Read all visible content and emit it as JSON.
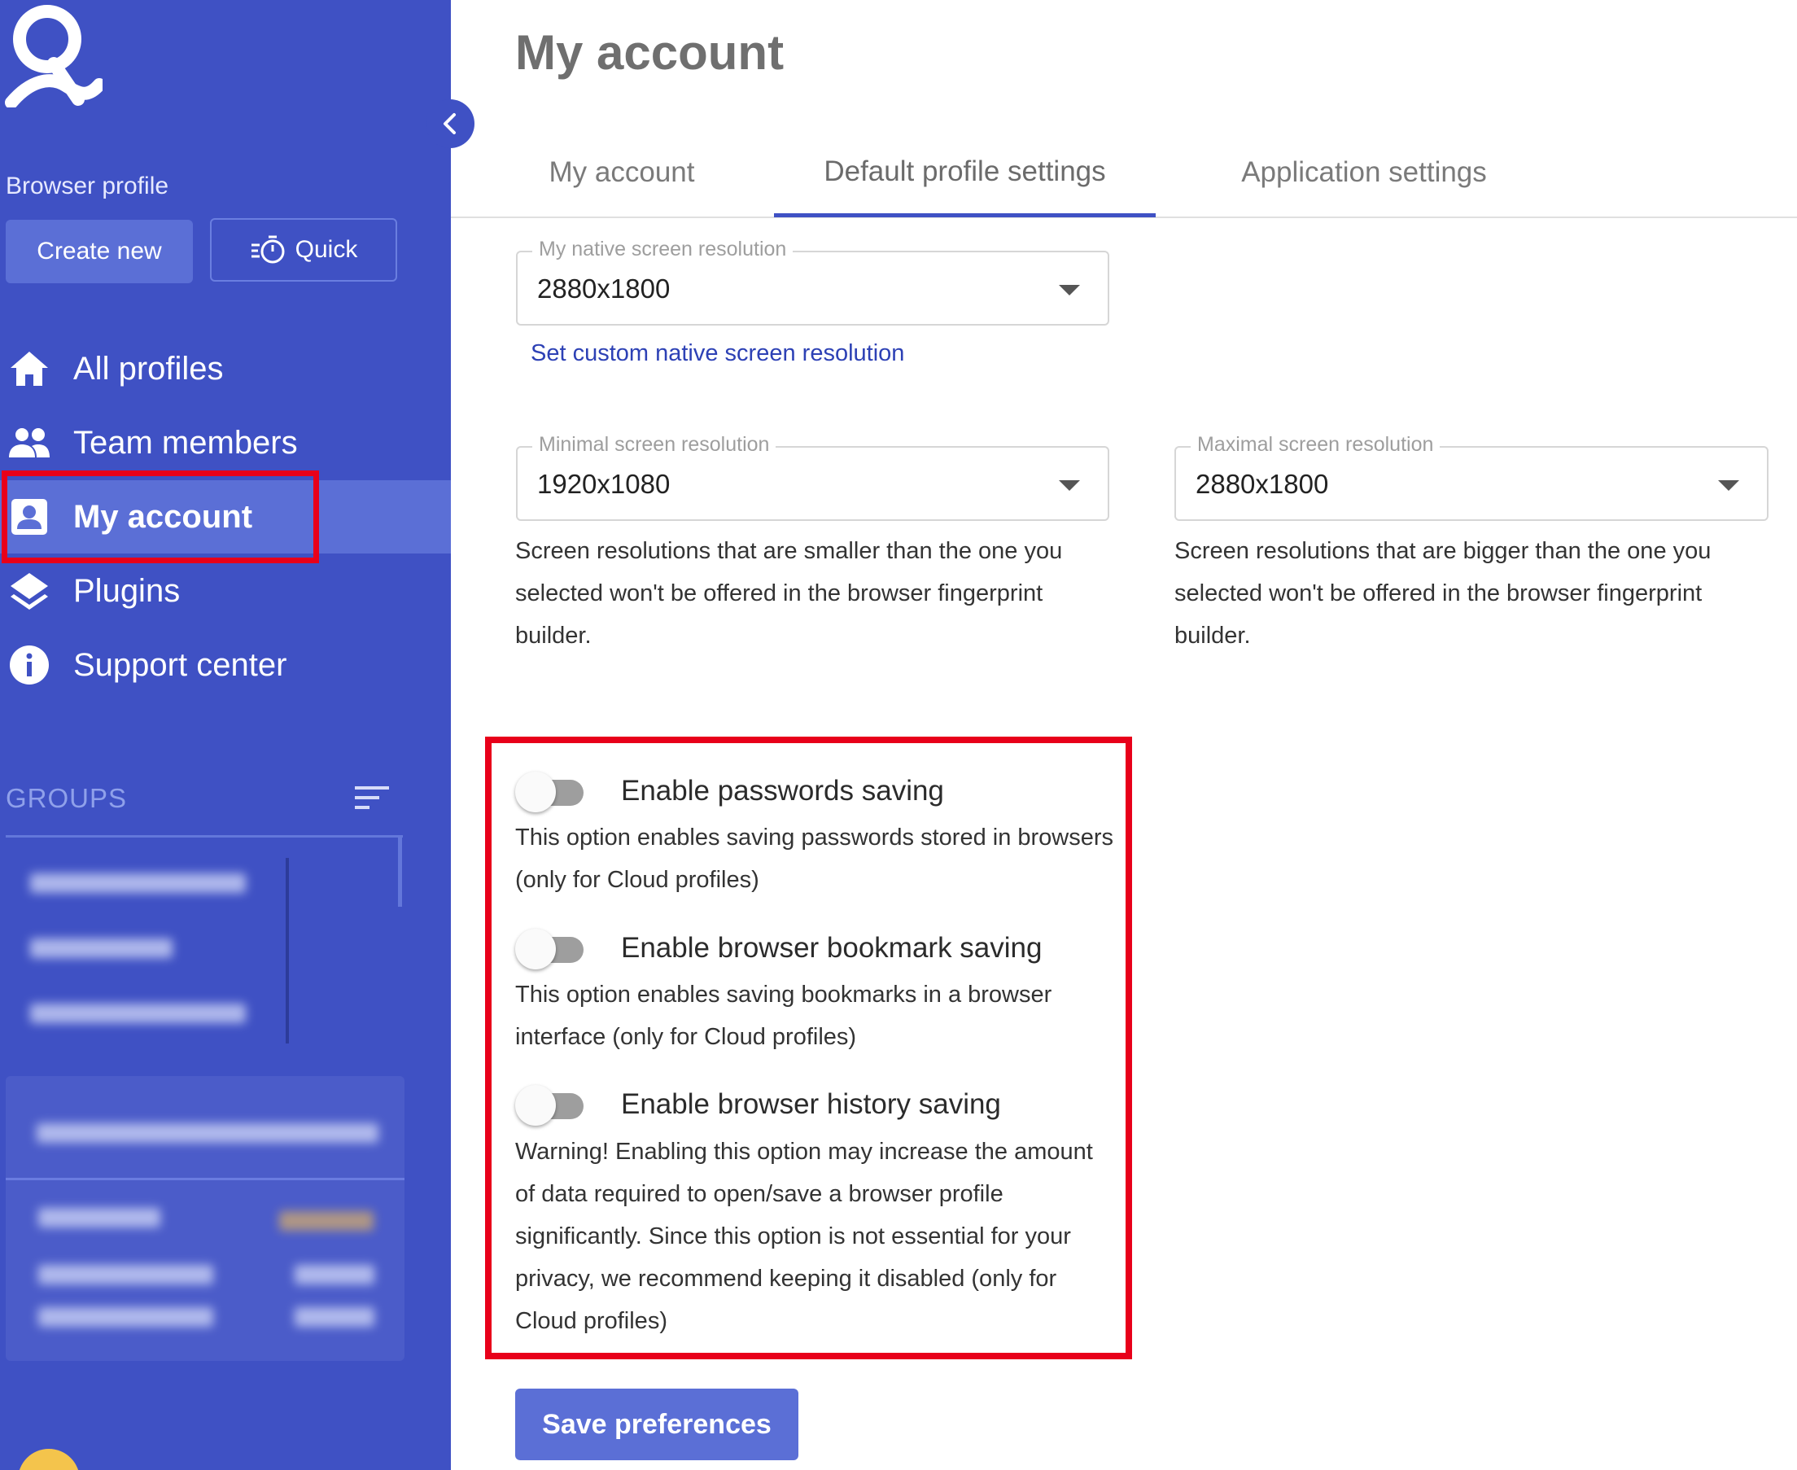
{
  "sidebar": {
    "profile_label": "Browser profile",
    "create_label": "Create new",
    "quick_label": "Quick",
    "nav": [
      {
        "label": "All profiles",
        "icon": "home-icon"
      },
      {
        "label": "Team members",
        "icon": "people-icon"
      },
      {
        "label": "My account",
        "icon": "account-box-icon",
        "active": true
      },
      {
        "label": "Plugins",
        "icon": "layers-icon"
      },
      {
        "label": "Support center",
        "icon": "info-icon"
      }
    ],
    "groups_label": "GROUPS"
  },
  "main": {
    "title": "My account",
    "tabs": [
      {
        "label": "My account"
      },
      {
        "label": "Default profile settings",
        "active": true
      },
      {
        "label": "Application settings"
      }
    ],
    "native_resolution": {
      "legend": "My native screen resolution",
      "value": "2880x1800",
      "custom_link": "Set custom native screen resolution"
    },
    "min_resolution": {
      "legend": "Minimal screen resolution",
      "value": "1920x1080",
      "hint": "Screen resolutions that are smaller than the one you selected won't be offered in the browser fingerprint builder."
    },
    "max_resolution": {
      "legend": "Maximal screen resolution",
      "value": "2880x1800",
      "hint": "Screen resolutions that are bigger than the one you selected won't be offered in the browser fingerprint builder."
    },
    "options": [
      {
        "label": "Enable passwords saving",
        "enabled": false,
        "description": "This option enables saving passwords stored in browsers (only for Cloud profiles)"
      },
      {
        "label": "Enable browser bookmark saving",
        "enabled": false,
        "description": "This option enables saving bookmarks in a browser interface (only for Cloud profiles)"
      },
      {
        "label": "Enable browser history saving",
        "enabled": false,
        "description": "Warning! Enabling this option may increase the amount of data required to open/save a browser profile significantly. Since this option is not essential for your privacy, we recommend keeping it disabled (only for Cloud profiles)"
      }
    ],
    "save_label": "Save preferences"
  },
  "colors": {
    "sidebar_bg": "#3f51c4",
    "accent": "#5b6fd6",
    "link": "#2d41b5",
    "highlight": "#e8001a"
  }
}
